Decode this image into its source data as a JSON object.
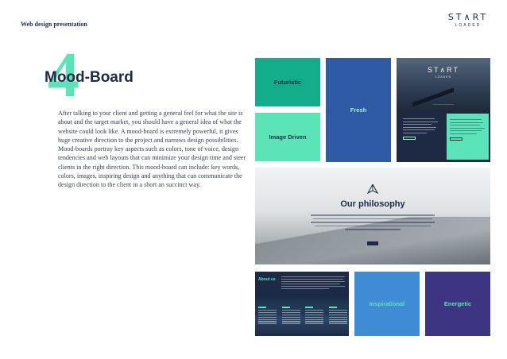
{
  "header": {
    "title": "Web design presentation"
  },
  "logo": {
    "word": "ST∧RT",
    "sub": "LOADED"
  },
  "section": {
    "number": "4",
    "title": "Mood-Board",
    "body": "After talking to your client and getting a general feel for what the site is about and the target market, you should have a general idea of what the website could look like. A mood-board is extremely powerful, it gives huge creative direction to the project and narrows design possibilities. Mood-boards portray key aspects such as colors, tone of voice, design tendencies and web layouts that can minimize your design time and steer clients in the right direction. This mood-board can include: key words, colors, images, inspiring design and anything that can communicate the design direction to the client in a short an succinct way."
  },
  "tiles": {
    "futuristic": "Futuristic",
    "image_driven": "Image Driven",
    "fresh": "Fresh",
    "inspirational": "Inspirational",
    "energetic": "Energetic"
  },
  "screenshot_1": {
    "logo": "ST∧RT",
    "sub": "LOADED"
  },
  "screenshot_2": {
    "title": "Our philosophy"
  },
  "screenshot_3": {
    "title": "About us"
  },
  "colors": {
    "navy": "#1e2a44",
    "mint": "#5ae4b8",
    "teal": "#14ad8b",
    "blue": "#2f5aa5",
    "sky": "#3f8bd4",
    "indigo": "#3d3582"
  }
}
